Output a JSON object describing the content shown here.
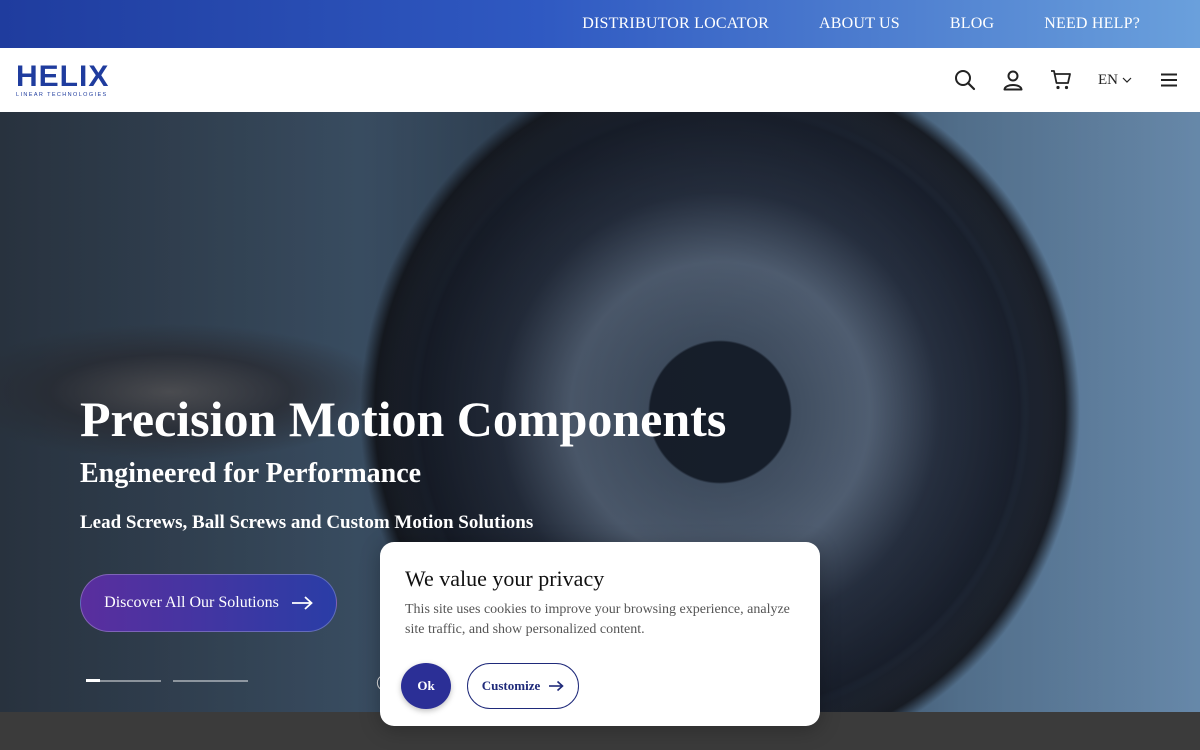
{
  "topbar": {
    "links": [
      "DISTRIBUTOR LOCATOR",
      "ABOUT US",
      "BLOG",
      "NEED HELP?"
    ]
  },
  "header": {
    "logo_main": "HELIX",
    "logo_sub": "LINEAR TECHNOLOGIES",
    "language": "EN",
    "icons": [
      "search-icon",
      "account-icon",
      "cart-icon",
      "chevron-down-icon",
      "menu-icon"
    ]
  },
  "hero": {
    "title": "Precision Motion Components",
    "subtitle": "Engineered for Performance",
    "tagline": "Lead Screws, Ball Screws and Custom Motion Solutions",
    "cta_label": "Discover All Our Solutions",
    "slides": 2,
    "active_slide": 1
  },
  "cookie": {
    "title": "We value your privacy",
    "text": "This site uses cookies to improve your browsing experience, analyze site traffic, and show personalized content.",
    "ok_label": "Ok",
    "customize_label": "Customize"
  },
  "colors": {
    "brand": "#1f3c9e",
    "accent_purple": "#5a2e9e",
    "ok_button": "#2b2f96"
  }
}
